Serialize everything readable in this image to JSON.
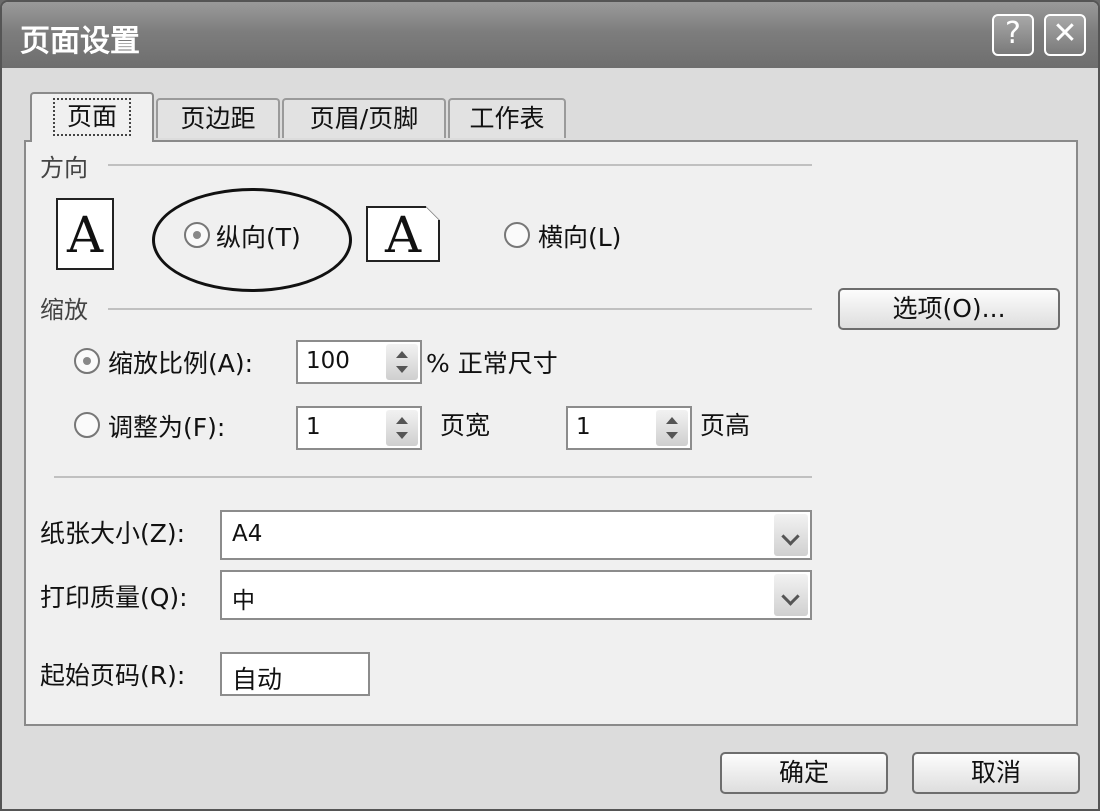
{
  "window": {
    "title": "页面设置",
    "help_label": "?",
    "close_label": "✕"
  },
  "tabs": [
    {
      "label": "页面"
    },
    {
      "label": "页边距"
    },
    {
      "label": "页眉/页脚"
    },
    {
      "label": "工作表"
    }
  ],
  "orientation": {
    "group_label": "方向",
    "icon_letter": "A",
    "portrait_label": "纵向(T)",
    "landscape_label": "横向(L)",
    "selected": "portrait"
  },
  "scaling": {
    "group_label": "缩放",
    "options_button": "选项(O)...",
    "adjust_label": "缩放比例(A):",
    "adjust_value": "100",
    "adjust_unit": "% 正常尺寸",
    "fit_label": "调整为(F):",
    "fit_wide_value": "1",
    "fit_wide_unit": "页宽",
    "fit_tall_value": "1",
    "fit_tall_unit": "页高"
  },
  "paper": {
    "size_label": "纸张大小(Z):",
    "size_value": "A4",
    "quality_label": "打印质量(Q):",
    "quality_value": "中",
    "first_page_label": "起始页码(R):",
    "first_page_value": "自动"
  },
  "footer": {
    "ok_label": "确定",
    "cancel_label": "取消"
  }
}
